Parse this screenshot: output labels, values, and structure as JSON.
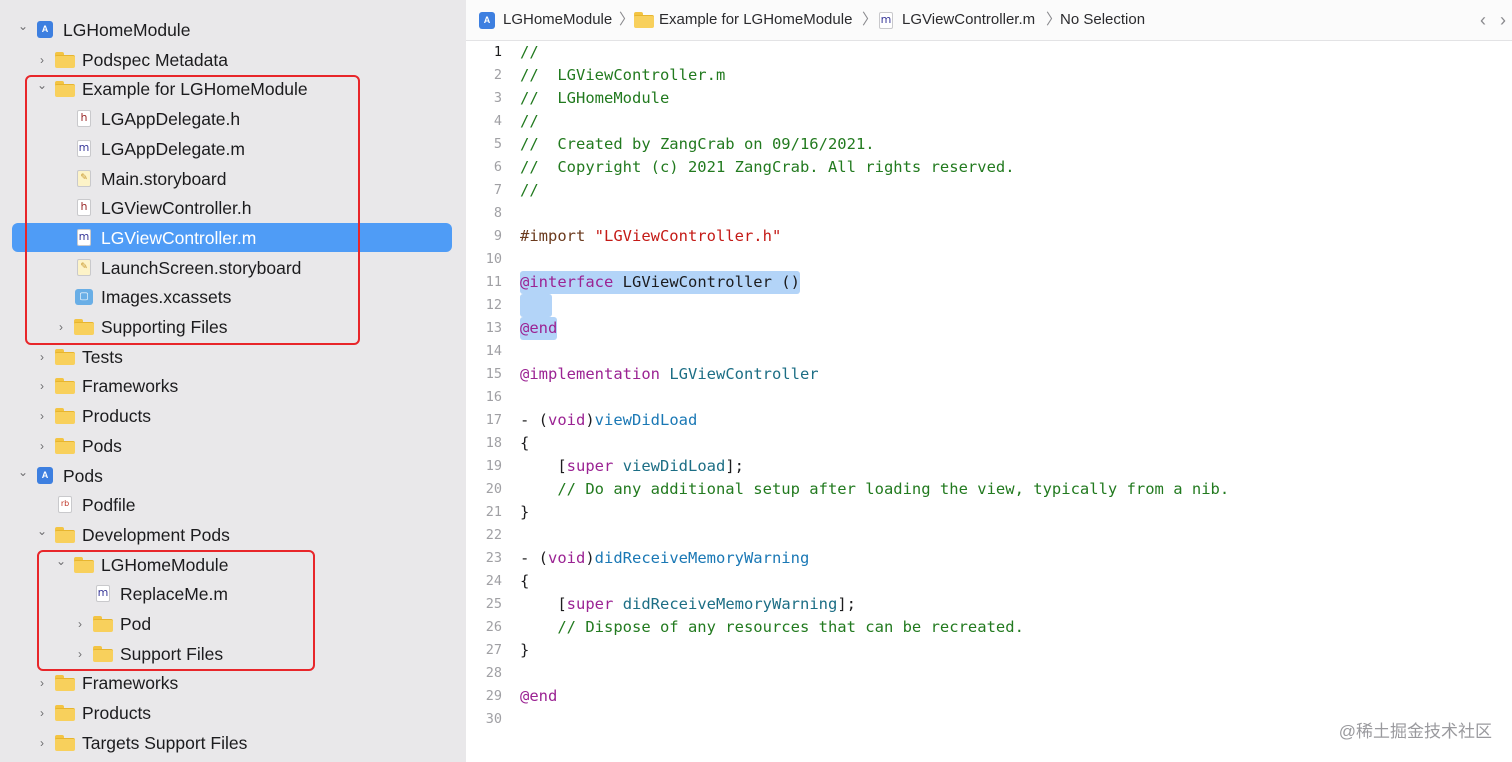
{
  "navigator": {
    "rows": [
      {
        "label": "LGHomeModule",
        "disc": "open",
        "icon": "project",
        "depth": 0
      },
      {
        "label": "Podspec Metadata",
        "disc": "closed",
        "icon": "folder",
        "depth": 1
      },
      {
        "label": "Example for LGHomeModule",
        "disc": "open",
        "icon": "folder",
        "depth": 1
      },
      {
        "label": "LGAppDelegate.h",
        "disc": "none",
        "icon": "h",
        "depth": 2
      },
      {
        "label": "LGAppDelegate.m",
        "disc": "none",
        "icon": "m",
        "depth": 2
      },
      {
        "label": "Main.storyboard",
        "disc": "none",
        "icon": "storyboard",
        "depth": 2
      },
      {
        "label": "LGViewController.h",
        "disc": "none",
        "icon": "h",
        "depth": 2
      },
      {
        "label": "LGViewController.m",
        "disc": "none",
        "icon": "m",
        "depth": 2,
        "selected": true
      },
      {
        "label": "LaunchScreen.storyboard",
        "disc": "none",
        "icon": "storyboard",
        "depth": 2
      },
      {
        "label": "Images.xcassets",
        "disc": "none",
        "icon": "assets",
        "depth": 2
      },
      {
        "label": "Supporting Files",
        "disc": "closed",
        "icon": "folder",
        "depth": 2
      },
      {
        "label": "Tests",
        "disc": "closed",
        "icon": "folder",
        "depth": 1
      },
      {
        "label": "Frameworks",
        "disc": "closed",
        "icon": "folder",
        "depth": 1
      },
      {
        "label": "Products",
        "disc": "closed",
        "icon": "folder",
        "depth": 1
      },
      {
        "label": "Pods",
        "disc": "closed",
        "icon": "folder",
        "depth": 1
      },
      {
        "label": "Pods",
        "disc": "open",
        "icon": "project",
        "depth": 0
      },
      {
        "label": "Podfile",
        "disc": "none",
        "icon": "rb",
        "depth": 1
      },
      {
        "label": "Development Pods",
        "disc": "open",
        "icon": "folder",
        "depth": 1
      },
      {
        "label": "LGHomeModule",
        "disc": "open",
        "icon": "folder",
        "depth": 2
      },
      {
        "label": "ReplaceMe.m",
        "disc": "none",
        "icon": "m",
        "depth": 3
      },
      {
        "label": "Pod",
        "disc": "closed",
        "icon": "folder",
        "depth": 3
      },
      {
        "label": "Support Files",
        "disc": "closed",
        "icon": "folder",
        "depth": 3
      },
      {
        "label": "Frameworks",
        "disc": "closed",
        "icon": "folder",
        "depth": 1
      },
      {
        "label": "Products",
        "disc": "closed",
        "icon": "folder",
        "depth": 1
      },
      {
        "label": "Targets Support Files",
        "disc": "closed",
        "icon": "folder",
        "depth": 1
      }
    ]
  },
  "jumpbar": {
    "crumbs": [
      "LGHomeModule",
      "Example for LGHomeModule",
      "LGViewController.m",
      "No Selection"
    ],
    "back_glyph": "‹",
    "forward_glyph": "›"
  },
  "editor": {
    "current_line": 1,
    "lines": [
      [
        [
          "//",
          "com"
        ]
      ],
      [
        [
          "//  LGViewController.m",
          "com"
        ]
      ],
      [
        [
          "//  LGHomeModule",
          "com"
        ]
      ],
      [
        [
          "//",
          "com"
        ]
      ],
      [
        [
          "//  Created by ZangCrab on 09/16/2021.",
          "com"
        ]
      ],
      [
        [
          "//  Copyright (c) 2021 ZangCrab. All rights reserved.",
          "com"
        ]
      ],
      [
        [
          "//",
          "com"
        ]
      ],
      [],
      [
        [
          "#import ",
          "dir"
        ],
        [
          "\"LGViewController.h\"",
          "str"
        ]
      ],
      [],
      [
        [
          "@interface",
          "key"
        ],
        [
          " LGViewController ()",
          "pln"
        ]
      ],
      [],
      [
        [
          "@end",
          "key"
        ]
      ],
      [],
      [
        [
          "@implementation",
          "key"
        ],
        [
          " ",
          "pln"
        ],
        [
          "LGViewController",
          "cls"
        ]
      ],
      [],
      [
        [
          "- (",
          "pln"
        ],
        [
          "void",
          "key"
        ],
        [
          ")",
          "pln"
        ],
        [
          "viewDidLoad",
          "fn"
        ]
      ],
      [
        [
          "{",
          "pln"
        ]
      ],
      [
        [
          "    [",
          "pln"
        ],
        [
          "super",
          "key"
        ],
        [
          " ",
          "pln"
        ],
        [
          "viewDidLoad",
          "cls"
        ],
        [
          "];",
          "pln"
        ]
      ],
      [
        [
          "    // Do any additional setup after loading the view, typically from a nib.",
          "com"
        ]
      ],
      [
        [
          "}",
          "pln"
        ]
      ],
      [],
      [
        [
          "- (",
          "pln"
        ],
        [
          "void",
          "key"
        ],
        [
          ")",
          "pln"
        ],
        [
          "didReceiveMemoryWarning",
          "fn"
        ]
      ],
      [
        [
          "{",
          "pln"
        ]
      ],
      [
        [
          "    [",
          "pln"
        ],
        [
          "super",
          "key"
        ],
        [
          " ",
          "pln"
        ],
        [
          "didReceiveMemoryWarning",
          "cls"
        ],
        [
          "];",
          "pln"
        ]
      ],
      [
        [
          "    // Dispose of any resources that can be recreated.",
          "com"
        ]
      ],
      [
        [
          "}",
          "pln"
        ]
      ],
      [],
      [
        [
          "@end",
          "key"
        ]
      ],
      []
    ],
    "highlight_lines": [
      11,
      12,
      13
    ]
  },
  "watermark": "@稀土掘金技术社区"
}
